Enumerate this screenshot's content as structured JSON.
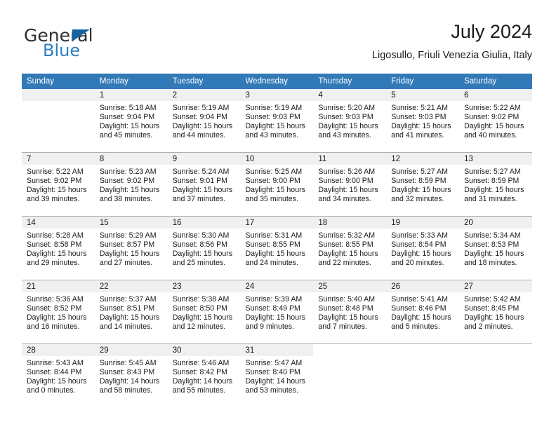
{
  "brand": {
    "name_top": "General",
    "name_bottom": "Blue",
    "triangle_color": "#1464a5",
    "blue_color": "#2e7ec1"
  },
  "header": {
    "month_title": "July 2024",
    "location": "Ligosullo, Friuli Venezia Giulia, Italy"
  },
  "theme": {
    "header_bg": "#3279b7",
    "header_text": "#ffffff",
    "daynum_bg": "#f0f0f0",
    "grid_line": "#aeaeae"
  },
  "weekdays": [
    "Sunday",
    "Monday",
    "Tuesday",
    "Wednesday",
    "Thursday",
    "Friday",
    "Saturday"
  ],
  "weeks": [
    [
      {
        "day": "",
        "sunrise": "",
        "sunset": "",
        "daylight1": "",
        "daylight2": ""
      },
      {
        "day": "1",
        "sunrise": "Sunrise: 5:18 AM",
        "sunset": "Sunset: 9:04 PM",
        "daylight1": "Daylight: 15 hours",
        "daylight2": "and 45 minutes."
      },
      {
        "day": "2",
        "sunrise": "Sunrise: 5:19 AM",
        "sunset": "Sunset: 9:04 PM",
        "daylight1": "Daylight: 15 hours",
        "daylight2": "and 44 minutes."
      },
      {
        "day": "3",
        "sunrise": "Sunrise: 5:19 AM",
        "sunset": "Sunset: 9:03 PM",
        "daylight1": "Daylight: 15 hours",
        "daylight2": "and 43 minutes."
      },
      {
        "day": "4",
        "sunrise": "Sunrise: 5:20 AM",
        "sunset": "Sunset: 9:03 PM",
        "daylight1": "Daylight: 15 hours",
        "daylight2": "and 43 minutes."
      },
      {
        "day": "5",
        "sunrise": "Sunrise: 5:21 AM",
        "sunset": "Sunset: 9:03 PM",
        "daylight1": "Daylight: 15 hours",
        "daylight2": "and 41 minutes."
      },
      {
        "day": "6",
        "sunrise": "Sunrise: 5:22 AM",
        "sunset": "Sunset: 9:02 PM",
        "daylight1": "Daylight: 15 hours",
        "daylight2": "and 40 minutes."
      }
    ],
    [
      {
        "day": "7",
        "sunrise": "Sunrise: 5:22 AM",
        "sunset": "Sunset: 9:02 PM",
        "daylight1": "Daylight: 15 hours",
        "daylight2": "and 39 minutes."
      },
      {
        "day": "8",
        "sunrise": "Sunrise: 5:23 AM",
        "sunset": "Sunset: 9:02 PM",
        "daylight1": "Daylight: 15 hours",
        "daylight2": "and 38 minutes."
      },
      {
        "day": "9",
        "sunrise": "Sunrise: 5:24 AM",
        "sunset": "Sunset: 9:01 PM",
        "daylight1": "Daylight: 15 hours",
        "daylight2": "and 37 minutes."
      },
      {
        "day": "10",
        "sunrise": "Sunrise: 5:25 AM",
        "sunset": "Sunset: 9:00 PM",
        "daylight1": "Daylight: 15 hours",
        "daylight2": "and 35 minutes."
      },
      {
        "day": "11",
        "sunrise": "Sunrise: 5:26 AM",
        "sunset": "Sunset: 9:00 PM",
        "daylight1": "Daylight: 15 hours",
        "daylight2": "and 34 minutes."
      },
      {
        "day": "12",
        "sunrise": "Sunrise: 5:27 AM",
        "sunset": "Sunset: 8:59 PM",
        "daylight1": "Daylight: 15 hours",
        "daylight2": "and 32 minutes."
      },
      {
        "day": "13",
        "sunrise": "Sunrise: 5:27 AM",
        "sunset": "Sunset: 8:59 PM",
        "daylight1": "Daylight: 15 hours",
        "daylight2": "and 31 minutes."
      }
    ],
    [
      {
        "day": "14",
        "sunrise": "Sunrise: 5:28 AM",
        "sunset": "Sunset: 8:58 PM",
        "daylight1": "Daylight: 15 hours",
        "daylight2": "and 29 minutes."
      },
      {
        "day": "15",
        "sunrise": "Sunrise: 5:29 AM",
        "sunset": "Sunset: 8:57 PM",
        "daylight1": "Daylight: 15 hours",
        "daylight2": "and 27 minutes."
      },
      {
        "day": "16",
        "sunrise": "Sunrise: 5:30 AM",
        "sunset": "Sunset: 8:56 PM",
        "daylight1": "Daylight: 15 hours",
        "daylight2": "and 25 minutes."
      },
      {
        "day": "17",
        "sunrise": "Sunrise: 5:31 AM",
        "sunset": "Sunset: 8:55 PM",
        "daylight1": "Daylight: 15 hours",
        "daylight2": "and 24 minutes."
      },
      {
        "day": "18",
        "sunrise": "Sunrise: 5:32 AM",
        "sunset": "Sunset: 8:55 PM",
        "daylight1": "Daylight: 15 hours",
        "daylight2": "and 22 minutes."
      },
      {
        "day": "19",
        "sunrise": "Sunrise: 5:33 AM",
        "sunset": "Sunset: 8:54 PM",
        "daylight1": "Daylight: 15 hours",
        "daylight2": "and 20 minutes."
      },
      {
        "day": "20",
        "sunrise": "Sunrise: 5:34 AM",
        "sunset": "Sunset: 8:53 PM",
        "daylight1": "Daylight: 15 hours",
        "daylight2": "and 18 minutes."
      }
    ],
    [
      {
        "day": "21",
        "sunrise": "Sunrise: 5:36 AM",
        "sunset": "Sunset: 8:52 PM",
        "daylight1": "Daylight: 15 hours",
        "daylight2": "and 16 minutes."
      },
      {
        "day": "22",
        "sunrise": "Sunrise: 5:37 AM",
        "sunset": "Sunset: 8:51 PM",
        "daylight1": "Daylight: 15 hours",
        "daylight2": "and 14 minutes."
      },
      {
        "day": "23",
        "sunrise": "Sunrise: 5:38 AM",
        "sunset": "Sunset: 8:50 PM",
        "daylight1": "Daylight: 15 hours",
        "daylight2": "and 12 minutes."
      },
      {
        "day": "24",
        "sunrise": "Sunrise: 5:39 AM",
        "sunset": "Sunset: 8:49 PM",
        "daylight1": "Daylight: 15 hours",
        "daylight2": "and 9 minutes."
      },
      {
        "day": "25",
        "sunrise": "Sunrise: 5:40 AM",
        "sunset": "Sunset: 8:48 PM",
        "daylight1": "Daylight: 15 hours",
        "daylight2": "and 7 minutes."
      },
      {
        "day": "26",
        "sunrise": "Sunrise: 5:41 AM",
        "sunset": "Sunset: 8:46 PM",
        "daylight1": "Daylight: 15 hours",
        "daylight2": "and 5 minutes."
      },
      {
        "day": "27",
        "sunrise": "Sunrise: 5:42 AM",
        "sunset": "Sunset: 8:45 PM",
        "daylight1": "Daylight: 15 hours",
        "daylight2": "and 2 minutes."
      }
    ],
    [
      {
        "day": "28",
        "sunrise": "Sunrise: 5:43 AM",
        "sunset": "Sunset: 8:44 PM",
        "daylight1": "Daylight: 15 hours",
        "daylight2": "and 0 minutes."
      },
      {
        "day": "29",
        "sunrise": "Sunrise: 5:45 AM",
        "sunset": "Sunset: 8:43 PM",
        "daylight1": "Daylight: 14 hours",
        "daylight2": "and 58 minutes."
      },
      {
        "day": "30",
        "sunrise": "Sunrise: 5:46 AM",
        "sunset": "Sunset: 8:42 PM",
        "daylight1": "Daylight: 14 hours",
        "daylight2": "and 55 minutes."
      },
      {
        "day": "31",
        "sunrise": "Sunrise: 5:47 AM",
        "sunset": "Sunset: 8:40 PM",
        "daylight1": "Daylight: 14 hours",
        "daylight2": "and 53 minutes."
      },
      {
        "day": "",
        "sunrise": "",
        "sunset": "",
        "daylight1": "",
        "daylight2": ""
      },
      {
        "day": "",
        "sunrise": "",
        "sunset": "",
        "daylight1": "",
        "daylight2": ""
      },
      {
        "day": "",
        "sunrise": "",
        "sunset": "",
        "daylight1": "",
        "daylight2": ""
      }
    ]
  ]
}
